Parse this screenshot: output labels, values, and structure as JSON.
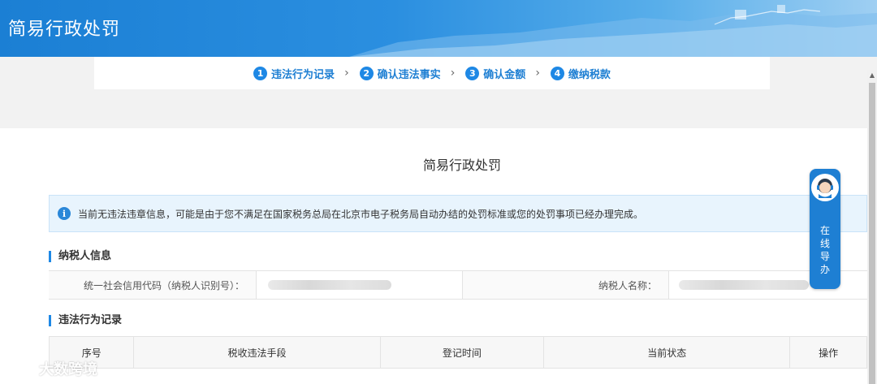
{
  "header": {
    "title": "简易行政处罚"
  },
  "steps": [
    {
      "num": "1",
      "label": "违法行为记录"
    },
    {
      "num": "2",
      "label": "确认违法事实"
    },
    {
      "num": "3",
      "label": "确认金额"
    },
    {
      "num": "4",
      "label": "缴纳税款"
    }
  ],
  "step_separator": "›",
  "main": {
    "title": "简易行政处罚",
    "notice": "当前无违法违章信息，可能是由于您不满足在国家税务总局在北京市电子税务局自动办结的处罚标准或您的处罚事项已经办理完成。",
    "taxpayer_section": "纳税人信息",
    "credit_code_label": "统一社会信用代码（纳税人识别号）：",
    "name_label": "纳税人名称：",
    "records_section": "违法行为记录",
    "columns": [
      "序号",
      "税收违法手段",
      "登记时间",
      "当前状态",
      "操作"
    ]
  },
  "guide": {
    "label": "在线导办"
  },
  "watermark": {
    "text": "大数跨境"
  },
  "colors": {
    "primary": "#1e88e5",
    "header": "#1b7fd4",
    "notice_bg": "#e8f4fd"
  }
}
